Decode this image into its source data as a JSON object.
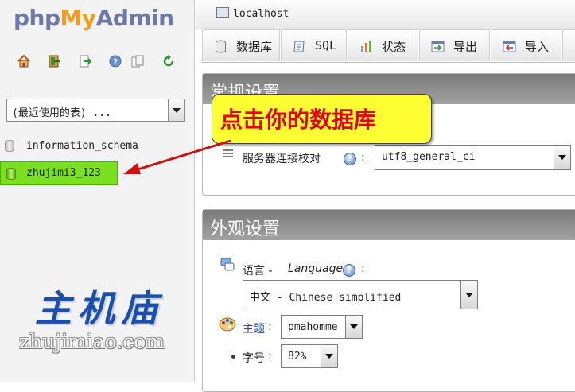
{
  "nav": {
    "logo": {
      "php": "php",
      "my": "My",
      "admin": "Admin"
    },
    "icons": [
      "home-icon",
      "exit-icon",
      "query-icon",
      "help-icon",
      "docs-icon",
      "reload-icon"
    ],
    "recent_select": {
      "value": "(最近使用的表) ..."
    },
    "databases": [
      {
        "name": "information_schema"
      },
      {
        "name": "zhujimi3_123",
        "highlight_color": "#7be020"
      }
    ]
  },
  "watermark": {
    "cn": "主机庙",
    "en": "zhujimiao.com"
  },
  "main": {
    "server_label": "localhost",
    "tabs": [
      {
        "label": "数据库",
        "icon": "database-icon"
      },
      {
        "label": "SQL",
        "icon": "sql-icon"
      },
      {
        "label": "状态",
        "icon": "status-icon"
      },
      {
        "label": "导出",
        "icon": "export-icon"
      },
      {
        "label": "导入",
        "icon": "import-icon"
      }
    ],
    "general_settings": {
      "title": "常规设置",
      "collation_label": "服务器连接校对",
      "collation_colon": ":",
      "collation_value": "utf8_general_ci"
    },
    "appearance": {
      "title": "外观设置",
      "language_label": "语言 - ",
      "language_italic": "Language",
      "language_colon": ":",
      "language_value": "中文 - Chinese simplified",
      "theme_label": "主题",
      "theme_colon": ":",
      "theme_value": "pmahomme",
      "fontsize_label": "字号",
      "fontsize_colon": ":",
      "fontsize_value": "82%"
    }
  },
  "annotation": {
    "text": "点击你的数据库",
    "background": "#ffff33",
    "text_color": "#e3001b",
    "arrow_color": "#d01010"
  }
}
